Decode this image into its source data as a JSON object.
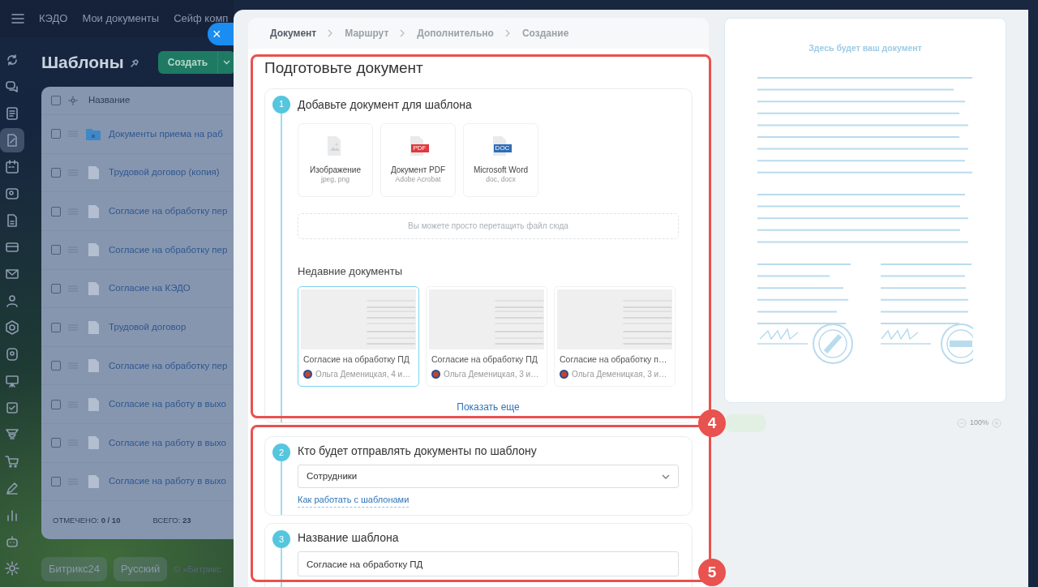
{
  "top_nav": {
    "items": [
      "КЭДО",
      "Мои документы",
      "Сейф комп"
    ]
  },
  "sidebar": {
    "items": [
      {
        "selected": false
      },
      {
        "selected": false
      },
      {
        "selected": false
      },
      {
        "selected": true
      },
      {
        "selected": false
      },
      {
        "selected": false
      },
      {
        "selected": false
      },
      {
        "selected": false
      },
      {
        "selected": false
      },
      {
        "selected": false
      },
      {
        "selected": false
      },
      {
        "selected": false
      },
      {
        "selected": false
      },
      {
        "selected": false
      },
      {
        "selected": false
      },
      {
        "selected": false
      },
      {
        "selected": false
      },
      {
        "selected": false
      },
      {
        "selected": false
      },
      {
        "selected": false
      }
    ]
  },
  "page": {
    "title": "Шаблоны",
    "create_button": "Создать"
  },
  "list": {
    "header": {
      "checked": false,
      "column": "Название"
    },
    "rows": [
      {
        "kind": "folder",
        "title": "Документы приема на раб",
        "checked": false
      },
      {
        "kind": "file",
        "title": "Трудовой договор (копия)",
        "checked": false
      },
      {
        "kind": "file",
        "title": "Согласие на обработку пер",
        "checked": false
      },
      {
        "kind": "file",
        "title": "Согласие на обработку пер",
        "checked": false
      },
      {
        "kind": "file",
        "title": "Согласие на КЭДО",
        "checked": false
      },
      {
        "kind": "file",
        "title": "Трудовой договор",
        "checked": false
      },
      {
        "kind": "file",
        "title": "Согласие на обработку пер",
        "checked": false
      },
      {
        "kind": "file",
        "title": "Согласие на работу в выхо",
        "checked": false
      },
      {
        "kind": "file",
        "title": "Согласие на работу в выхо",
        "checked": false
      },
      {
        "kind": "file",
        "title": "Согласие на работу в выхо",
        "checked": false
      }
    ],
    "footer": {
      "selected_count": "ОТМЕЧЕНО: **0 / 10**",
      "total": "ВСЕГО: **23**"
    }
  },
  "footer_bar": {
    "brand": "Битрикс24",
    "language": "Русский",
    "copyright": "© «Битрикс"
  },
  "close_button": "×",
  "wizard": {
    "steps": [
      {
        "label": "Документ",
        "selected": true
      },
      {
        "label": "Маршрут",
        "selected": false
      },
      {
        "label": "Дополнительно",
        "selected": false
      },
      {
        "label": "Создание",
        "selected": false
      }
    ],
    "heading": "Подготовьте документ",
    "document_section": {
      "number": "1",
      "title": "Добавьте документ для шаблона",
      "upload_types": [
        {
          "kind": "image",
          "name": "Изображение",
          "formats": "jpeg, png"
        },
        {
          "kind": "pdf",
          "name": "Документ PDF",
          "formats": "Adobe Acrobat",
          "badge": "PDF"
        },
        {
          "kind": "doc",
          "name": "Microsoft Word",
          "formats": "doc, docx",
          "badge": "DOC"
        }
      ],
      "dropzone": "Вы можете просто перетащить файл сюда",
      "recent_title": "Недавние документы",
      "recent": [
        {
          "title": "Согласие на обработку ПД",
          "author": "Ольга Деменицкая, 4 и…",
          "selected": true
        },
        {
          "title": "Согласие на обработку ПД",
          "author": "Ольга Деменицкая, 3 и…",
          "selected": false
        },
        {
          "title": "Согласие на обработку п…",
          "author": "Ольга Деменицкая, 3 и…",
          "selected": false
        }
      ],
      "show_more": "Показать еще"
    },
    "sender_section": {
      "number": "2",
      "title": "Кто будет отправлять документы по шаблону",
      "select_value": "Сотрудники",
      "help_link": "Как работать с шаблонами"
    },
    "name_section": {
      "number": "3",
      "title": "Название шаблона",
      "value": "Согласие на обработку ПД"
    }
  },
  "preview": {
    "caption": "Здесь будет ваш документ",
    "zoom": "100%"
  },
  "annotations": [
    {
      "label": "4"
    },
    {
      "label": "5"
    }
  ]
}
